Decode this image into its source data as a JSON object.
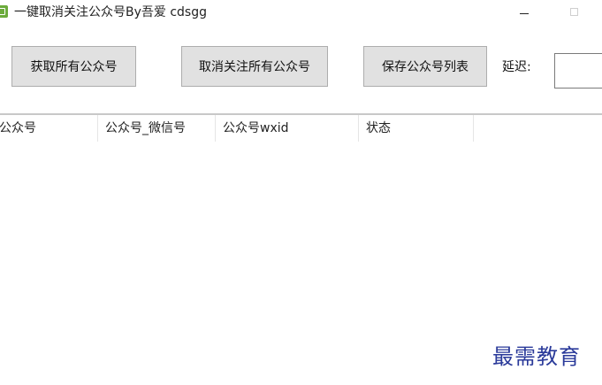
{
  "window": {
    "title": "一键取消关注公众号By吾爱 cdsgg",
    "icon": "app-icon"
  },
  "toolbar": {
    "get_all_label": "获取所有公众号",
    "unfollow_all_label": "取消关注所有公众号",
    "save_list_label": "保存公众号列表",
    "delay_label": "延迟:",
    "delay_value": ""
  },
  "list": {
    "columns": [
      "公众号",
      "公众号_微信号",
      "公众号wxid",
      "状态"
    ],
    "rows": []
  },
  "watermark": "最需教育",
  "colors": {
    "button_bg": "#e1e1e1",
    "button_border": "#adadad",
    "watermark": "#2a3a9a"
  }
}
